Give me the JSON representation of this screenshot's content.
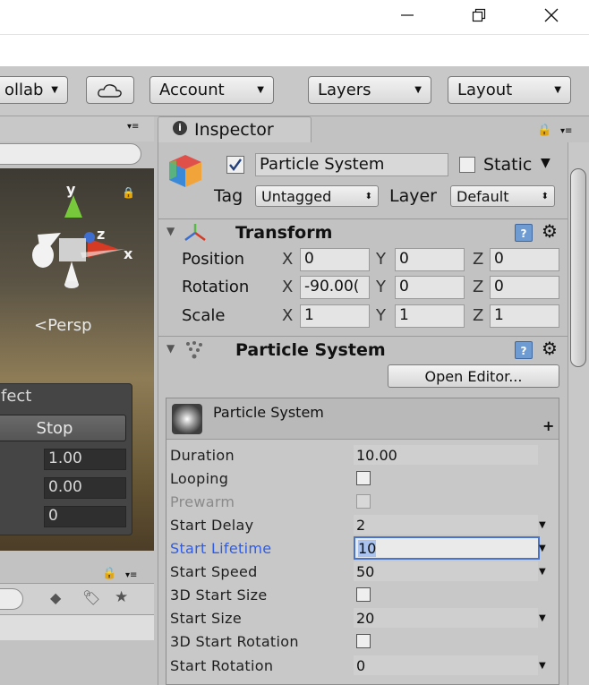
{
  "window_controls": {
    "minimize": "—",
    "maximize": "❐",
    "close": "✕"
  },
  "toolbar": {
    "collab_label": "ollab",
    "account_label": "Account",
    "layers_label": "Layers",
    "layout_label": "Layout"
  },
  "scene": {
    "gizmo_y": "y",
    "gizmo_x": "x",
    "gizmo_z": "z",
    "persp_label": "Persp",
    "effect_title": "fect",
    "stop_label": "Stop",
    "values": [
      "1.00",
      "0.00",
      "0"
    ]
  },
  "inspector": {
    "tab_label": "Inspector",
    "object_name": "Particle System",
    "static_label": "Static",
    "tag_label": "Tag",
    "tag_value": "Untagged",
    "layer_label": "Layer",
    "layer_value": "Default",
    "transform": {
      "title": "Transform",
      "rows": [
        {
          "label": "Position",
          "x": "0",
          "y": "0",
          "z": "0"
        },
        {
          "label": "Rotation",
          "x": "-90.00(",
          "y": "0",
          "z": "0"
        },
        {
          "label": "Scale",
          "x": "1",
          "y": "1",
          "z": "1"
        }
      ],
      "axis_x": "X",
      "axis_y": "Y",
      "axis_z": "Z"
    },
    "particle_component": {
      "title": "Particle System",
      "open_editor_label": "Open Editor..."
    },
    "module": {
      "title": "Particle System",
      "plus": "+",
      "rows": [
        {
          "label": "Duration",
          "value": "10.00",
          "kind": "field"
        },
        {
          "label": "Looping",
          "value": "",
          "kind": "checkbox"
        },
        {
          "label": "Prewarm",
          "value": "",
          "kind": "checkbox-disabled"
        },
        {
          "label": "Start Delay",
          "value": "2",
          "kind": "dropdown"
        },
        {
          "label": "Start Lifetime",
          "value": "10",
          "kind": "active-dropdown"
        },
        {
          "label": "Start Speed",
          "value": "50",
          "kind": "dropdown"
        },
        {
          "label": "3D Start Size",
          "value": "",
          "kind": "checkbox"
        },
        {
          "label": "Start Size",
          "value": "20",
          "kind": "dropdown"
        },
        {
          "label": "3D Start Rotation",
          "value": "",
          "kind": "checkbox"
        },
        {
          "label": "Start Rotation",
          "value": "0",
          "kind": "dropdown"
        }
      ]
    }
  },
  "colors": {
    "active_label": "#2f5ce6",
    "focus_border": "#4a74c9"
  }
}
